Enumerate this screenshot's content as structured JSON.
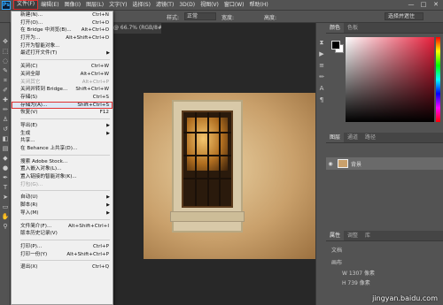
{
  "menubar": {
    "logo": "Ps",
    "items": [
      "文件(F)",
      "编辑(E)",
      "图像(I)",
      "图层(L)",
      "文字(Y)",
      "选择(S)",
      "滤镜(T)",
      "3D(D)",
      "视图(V)",
      "窗口(W)",
      "帮助(H)"
    ]
  },
  "window_controls": [
    "—",
    "□",
    "✕"
  ],
  "options": {
    "style_label": "样式:",
    "style_value": "正常",
    "width_label": "宽度:",
    "height_label": "高度:",
    "mask_button": "选择并遮住 ...",
    "workspace": "选择并遮住"
  },
  "document_tab": "@ 66.7% (RGB/8#) *",
  "file_menu": [
    {
      "label": "新建(N)...",
      "shortcut": "Ctrl+N"
    },
    {
      "label": "打开(O)...",
      "shortcut": "Ctrl+O"
    },
    {
      "label": "在 Bridge 中浏览(B)...",
      "shortcut": "Alt+Ctrl+O"
    },
    {
      "label": "打开为...",
      "shortcut": "Alt+Shift+Ctrl+O"
    },
    {
      "label": "打开为智能对象...",
      "shortcut": ""
    },
    {
      "label": "最近打开文件(T)",
      "shortcut": "",
      "submenu": true
    },
    {
      "separator": true
    },
    {
      "label": "关闭(C)",
      "shortcut": "Ctrl+W"
    },
    {
      "label": "关闭全部",
      "shortcut": "Alt+Ctrl+W"
    },
    {
      "label": "关闭其它",
      "shortcut": "Alt+Ctrl+P",
      "disabled": true
    },
    {
      "label": "关闭并转到 Bridge...",
      "shortcut": "Shift+Ctrl+W"
    },
    {
      "label": "存储(S)",
      "shortcut": "Ctrl+S"
    },
    {
      "label": "存储为(A)...",
      "shortcut": "Shift+Ctrl+S",
      "highlight": true
    },
    {
      "label": "恢复(V)",
      "shortcut": "F12"
    },
    {
      "separator": true
    },
    {
      "label": "导出(E)",
      "shortcut": "",
      "submenu": true
    },
    {
      "label": "生成",
      "shortcut": "",
      "submenu": true
    },
    {
      "label": "共享...",
      "shortcut": ""
    },
    {
      "label": "在 Behance 上共享(D)...",
      "shortcut": ""
    },
    {
      "separator": true
    },
    {
      "label": "搜索 Adobe Stock...",
      "shortcut": ""
    },
    {
      "label": "置入嵌入对象(L)...",
      "shortcut": ""
    },
    {
      "label": "置入链接的智能对象(K)...",
      "shortcut": ""
    },
    {
      "label": "打包(G)...",
      "shortcut": "",
      "disabled": true
    },
    {
      "separator": true
    },
    {
      "label": "自动(U)",
      "shortcut": "",
      "submenu": true
    },
    {
      "label": "脚本(R)",
      "shortcut": "",
      "submenu": true
    },
    {
      "label": "导入(M)",
      "shortcut": "",
      "submenu": true
    },
    {
      "separator": true
    },
    {
      "label": "文件简介(F)...",
      "shortcut": "Alt+Shift+Ctrl+I"
    },
    {
      "label": "版本历史记录(V)",
      "shortcut": ""
    },
    {
      "separator": true
    },
    {
      "label": "打印(P)...",
      "shortcut": "Ctrl+P"
    },
    {
      "label": "打印一份(Y)",
      "shortcut": "Alt+Shift+Ctrl+P"
    },
    {
      "separator": true
    },
    {
      "label": "退出(X)",
      "shortcut": "Ctrl+Q"
    }
  ],
  "panels": {
    "color_tabs": [
      "颜色",
      "色板"
    ],
    "layer_tabs": [
      "图层",
      "通道",
      "路径"
    ],
    "layer_name": "背景",
    "props_tabs": [
      "属性",
      "调整",
      "库"
    ],
    "props_rows": [
      "文档",
      "画布",
      "W  1307 像素",
      "H  739 像素"
    ],
    "colors": {
      "accent_red": "#e03030",
      "panel_bg": "#535353",
      "menu_bg": "#f0f0f0"
    }
  },
  "watermark": "jingyan.baidu.com"
}
